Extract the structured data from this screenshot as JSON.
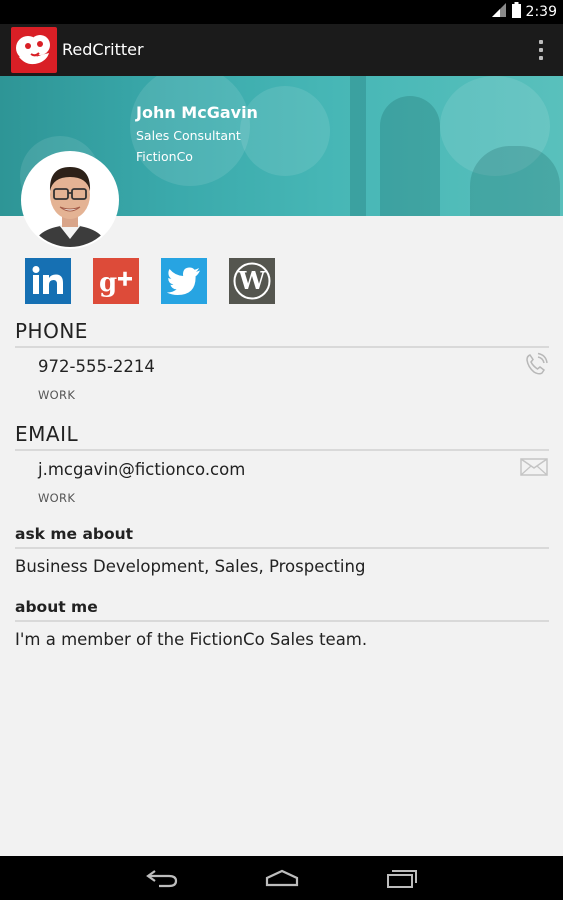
{
  "status_bar": {
    "time": "2:39"
  },
  "app": {
    "title": "RedCritter"
  },
  "profile": {
    "name": "John McGavin",
    "job_title": "Sales Consultant",
    "company": "FictionCo"
  },
  "social": [
    {
      "name": "linkedin-icon",
      "color": "#1670b3"
    },
    {
      "name": "google-plus-icon",
      "color": "#dd4b39"
    },
    {
      "name": "twitter-icon",
      "color": "#27a4e2"
    },
    {
      "name": "wordpress-icon",
      "color": "#55564f"
    }
  ],
  "phone": {
    "header": "PHONE",
    "value": "972-555-2214",
    "type": "WORK",
    "icon": "phone-icon"
  },
  "email": {
    "header": "EMAIL",
    "value": "j.mcgavin@fictionco.com",
    "type": "WORK",
    "icon": "mail-icon"
  },
  "ask_me_about": {
    "header": "ask me about",
    "text": "Business Development, Sales, Prospecting"
  },
  "about_me": {
    "header": "about me",
    "text": "I'm a member of the FictionCo Sales team."
  },
  "navigation": [
    "back-icon",
    "home-icon",
    "recent-apps-icon"
  ]
}
